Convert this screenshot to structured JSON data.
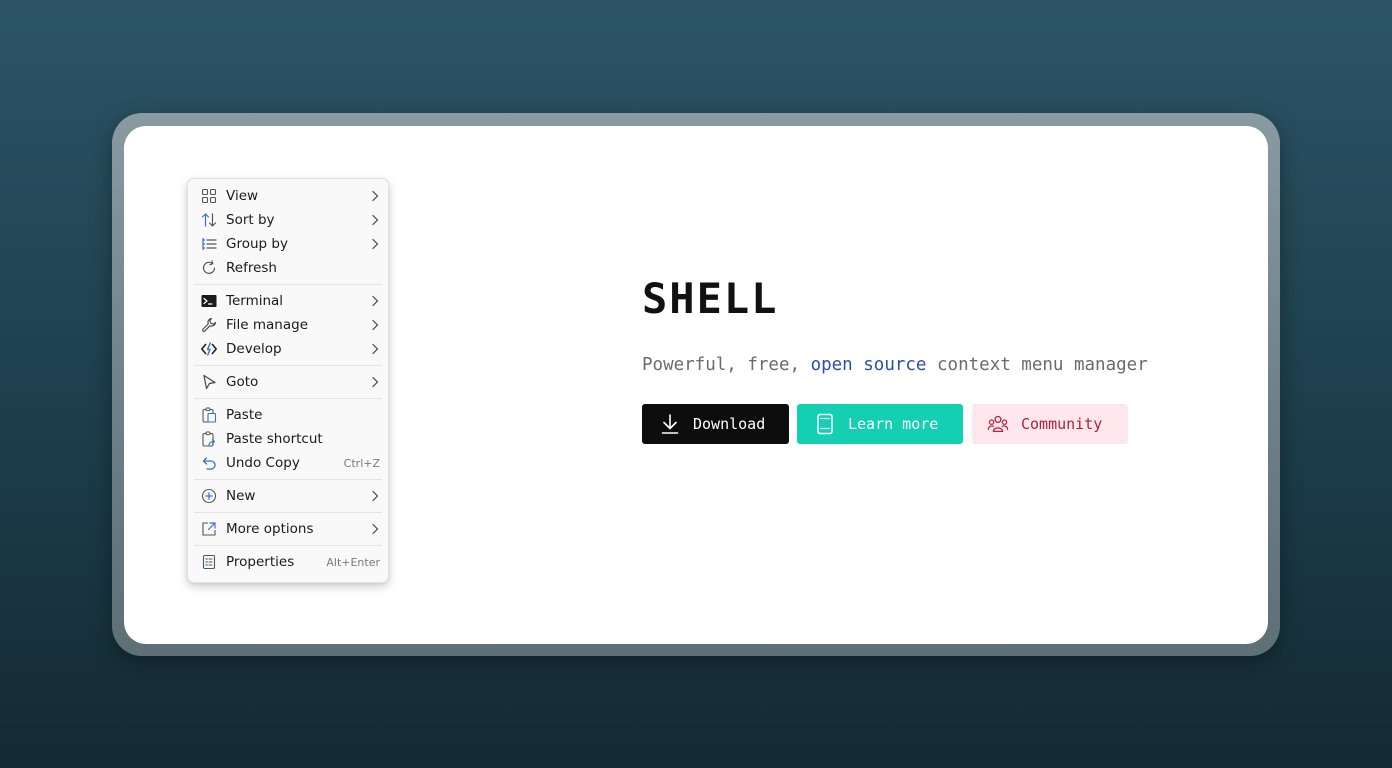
{
  "menu": {
    "groups": [
      {
        "items": [
          {
            "label": "View",
            "icon": "grid-icon",
            "submenu": true
          },
          {
            "label": "Sort by",
            "icon": "sort-arrows-icon",
            "submenu": true
          },
          {
            "label": "Group by",
            "icon": "list-icon",
            "submenu": true
          },
          {
            "label": "Refresh",
            "icon": "refresh-icon",
            "submenu": false
          }
        ]
      },
      {
        "items": [
          {
            "label": "Terminal",
            "icon": "terminal-icon",
            "submenu": true
          },
          {
            "label": "File manage",
            "icon": "wrench-icon",
            "submenu": true
          },
          {
            "label": "Develop",
            "icon": "code-icon",
            "submenu": true
          }
        ]
      },
      {
        "items": [
          {
            "label": "Goto",
            "icon": "pointer-icon",
            "submenu": true
          }
        ]
      },
      {
        "items": [
          {
            "label": "Paste",
            "icon": "paste-icon",
            "submenu": false
          },
          {
            "label": "Paste shortcut",
            "icon": "paste-shortcut-icon",
            "submenu": false
          },
          {
            "label": "Undo Copy",
            "icon": "undo-icon",
            "submenu": false,
            "shortcut": "Ctrl+Z"
          }
        ]
      },
      {
        "items": [
          {
            "label": "New",
            "icon": "plus-circle-icon",
            "submenu": true
          }
        ]
      },
      {
        "items": [
          {
            "label": "More options",
            "icon": "external-icon",
            "submenu": true
          }
        ]
      },
      {
        "items": [
          {
            "label": "Properties",
            "icon": "properties-icon",
            "submenu": false,
            "shortcut": "Alt+Enter"
          }
        ]
      }
    ]
  },
  "hero": {
    "title": "SHELL",
    "subtitle_before": "Powerful, free, ",
    "subtitle_accent": "open source",
    "subtitle_after": " context menu manager"
  },
  "buttons": {
    "download": {
      "label": "Download",
      "icon": "download-icon"
    },
    "learn_more": {
      "label": "Learn more",
      "icon": "book-icon"
    },
    "community": {
      "label": "Community",
      "icon": "people-icon"
    }
  },
  "colors": {
    "accent_blue": "#2b4fa8",
    "learn_more_bg": "#14cfb2",
    "community_bg": "#fde7ec",
    "community_text": "#b1223f",
    "download_bg": "#0d0d0d"
  }
}
